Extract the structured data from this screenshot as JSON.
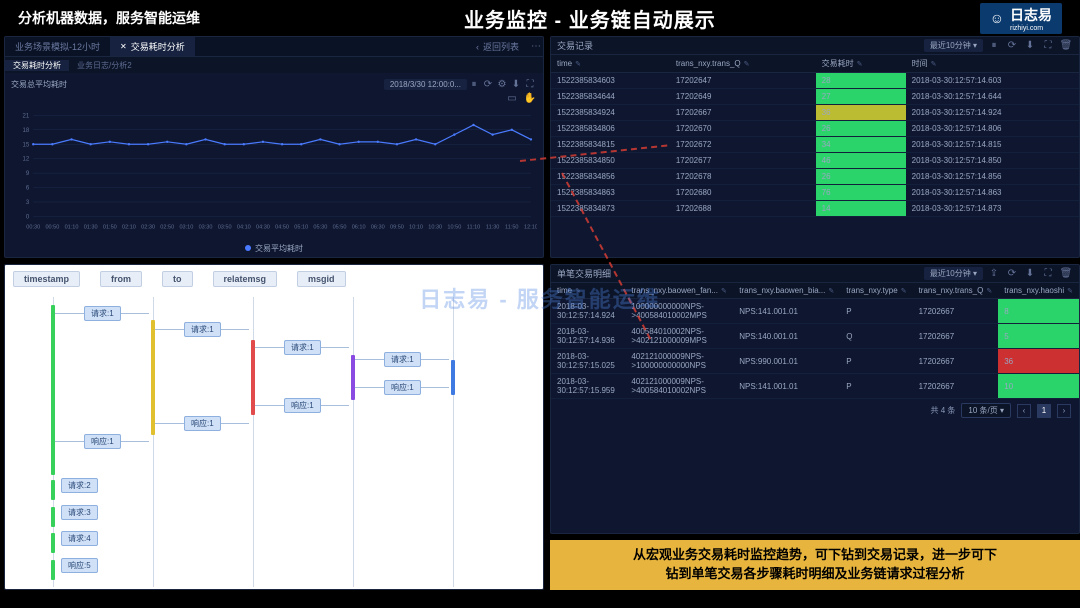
{
  "header": {
    "tagline": "分析机器数据，服务智能运维",
    "title": "业务监控 - 业务链自动展示",
    "brand": "日志易",
    "brand_sub": "rizhiyi.com"
  },
  "chart_panel": {
    "tabs": [
      "业务场景模拟-12小时",
      "交易耗时分析"
    ],
    "subtabs": [
      "交易耗时分析",
      "业务日志/分析2"
    ],
    "back": "返回列表",
    "title": "交易总平均耗时",
    "datetime": "2018/3/30 12:00:0...",
    "legend": "交易平均耗时",
    "icons": [
      "pause",
      "refresh",
      "settings",
      "download",
      "fullscreen"
    ],
    "tool_icons": [
      "zoom-in",
      "hand"
    ]
  },
  "chart_data": {
    "type": "line",
    "title": "交易总平均耗时",
    "xlabel": "",
    "ylabel": "",
    "x": [
      "00:30",
      "00:50",
      "01:10",
      "01:30",
      "01:50",
      "02:10",
      "02:30",
      "02:50",
      "03:10",
      "03:30",
      "03:50",
      "04:10",
      "04:30",
      "04:50",
      "05:10",
      "05:30",
      "05:50",
      "06:10",
      "06:30",
      "09:50",
      "10:10",
      "10:30",
      "10:50",
      "11:10",
      "11:30",
      "11:50",
      "12:10"
    ],
    "values": [
      15,
      15,
      16,
      15,
      15.5,
      15,
      15,
      15.5,
      15,
      16,
      15,
      15,
      15.5,
      15,
      15,
      16,
      15,
      15.5,
      15.5,
      15,
      16,
      15,
      17,
      19,
      17,
      18,
      16
    ],
    "ylim": [
      0,
      21
    ],
    "y_ticks": [
      0,
      3,
      6,
      9,
      12,
      15,
      18,
      21
    ],
    "legend": "交易平均耗时"
  },
  "records": {
    "title": "交易记录",
    "range": "最近10分钟",
    "icons": [
      "pause",
      "refresh",
      "download",
      "fullscreen",
      "delete"
    ],
    "cols": [
      "time",
      "trans_nxy.trans_Q",
      "交易耗时",
      "时间"
    ],
    "rows": [
      {
        "t": "1522385834603",
        "q": "17202647",
        "v": 28,
        "cls": "cell-green",
        "ts": "2018-03-30:12:57:14.603"
      },
      {
        "t": "1522385834644",
        "q": "17202649",
        "v": 27,
        "cls": "cell-green",
        "ts": "2018-03-30:12:57:14.644"
      },
      {
        "t": "1522385834924",
        "q": "17202667",
        "v": 36,
        "cls": "cell-olive",
        "ts": "2018-03-30:12:57:14.924"
      },
      {
        "t": "1522385834806",
        "q": "17202670",
        "v": 26,
        "cls": "cell-green",
        "ts": "2018-03-30:12:57:14.806"
      },
      {
        "t": "1522385834815",
        "q": "17202672",
        "v": 34,
        "cls": "cell-green",
        "ts": "2018-03-30:12:57:14.815"
      },
      {
        "t": "1522385834850",
        "q": "17202677",
        "v": 46,
        "cls": "cell-green",
        "ts": "2018-03-30:12:57:14.850"
      },
      {
        "t": "1522385834856",
        "q": "17202678",
        "v": 26,
        "cls": "cell-green",
        "ts": "2018-03-30:12:57:14.856"
      },
      {
        "t": "1522385834863",
        "q": "17202680",
        "v": 76,
        "cls": "cell-green",
        "ts": "2018-03-30:12:57:14.863"
      },
      {
        "t": "1522385834873",
        "q": "17202688",
        "v": 14,
        "cls": "cell-green",
        "ts": "2018-03-30:12:57:14.873"
      }
    ]
  },
  "flow": {
    "headers": [
      "timestamp",
      "from",
      "to",
      "relatemsg",
      "msgid"
    ],
    "labels": {
      "req": "请求:1",
      "res": "响应:1",
      "req2": "请求:2",
      "req3": "请求:3",
      "req4": "请求:4",
      "req5": "响应:5"
    }
  },
  "detail": {
    "title": "单笔交易明细",
    "range": "最近10分钟",
    "icons": [
      "export",
      "refresh",
      "download",
      "fullscreen",
      "delete"
    ],
    "cols": [
      "time",
      "trans_nxy.baowen_fan...",
      "trans_nxy.baowen_bia...",
      "trans_nxy.type",
      "trans_nxy.trans_Q",
      "trans_nxy.haoshi"
    ],
    "rows": [
      {
        "time": "2018-03-30:12:57:14.924",
        "fan": "100000000000NPS->400584010002MPS",
        "bia": "NPS:141.001.01",
        "type": "P",
        "q": "17202667",
        "h": 8,
        "cls": "cell-green"
      },
      {
        "time": "2018-03-30:12:57:14.936",
        "fan": "400584010002NPS->402121000009MPS",
        "bia": "NPS:140.001.01",
        "type": "Q",
        "q": "17202667",
        "h": 5,
        "cls": "cell-green"
      },
      {
        "time": "2018-03-30:12:57:15.025",
        "fan": "402121000009NPS->100000000000NPS",
        "bia": "NPS:990.001.01",
        "type": "P",
        "q": "17202667",
        "h": 36,
        "cls": "cell-red"
      },
      {
        "time": "2018-03-30:12:57:15.959",
        "fan": "402121000009NPS->400584010002NPS",
        "bia": "NPS:141.001.01",
        "type": "P",
        "q": "17202667",
        "h": 10,
        "cls": "cell-green"
      }
    ],
    "pager": {
      "total": "共 4 条",
      "per": "10 条/页",
      "page": "1"
    }
  },
  "caption": {
    "l1": "从宏观业务交易耗时监控趋势，可下钻到交易记录，进一步可下",
    "l2": "钻到单笔交易各步骤耗时明细及业务链请求过程分析"
  },
  "watermark": "日志易 - 服务智能运维"
}
